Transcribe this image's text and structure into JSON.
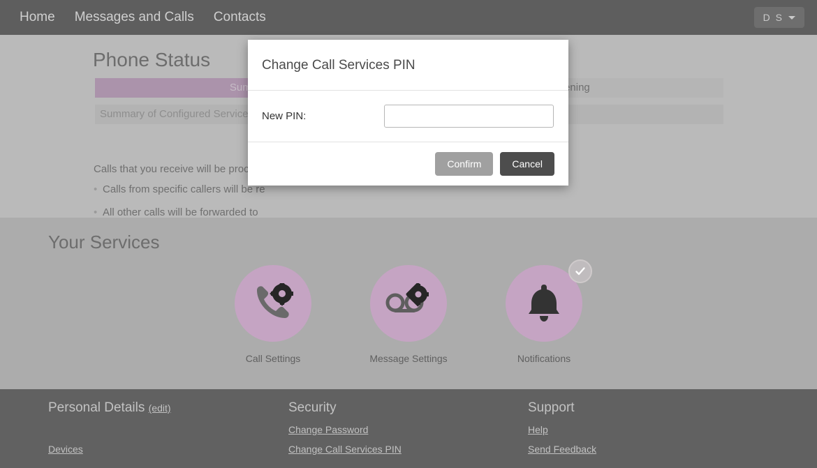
{
  "nav": {
    "links": [
      {
        "label": "Home"
      },
      {
        "label": "Messages and Calls"
      },
      {
        "label": "Contacts"
      }
    ],
    "user_initials": "D S"
  },
  "phone_status": {
    "title": "Phone Status",
    "tabs": [
      {
        "label": "Summary",
        "active": true
      },
      {
        "label": "Screening",
        "active": false
      }
    ],
    "subheader": "Summary of Configured Services",
    "intro": "Calls that you receive will be process",
    "bullets": [
      "Calls from specific callers will be re",
      "All other calls will be forwarded to"
    ]
  },
  "services": {
    "title": "Your Services",
    "items": [
      {
        "label": "Call Settings",
        "icon": "phone-gear-icon",
        "badge": false
      },
      {
        "label": "Message Settings",
        "icon": "voicemail-gear-icon",
        "badge": false
      },
      {
        "label": "Notifications",
        "icon": "bell-icon",
        "badge": true
      }
    ]
  },
  "footer": {
    "columns": [
      {
        "heading": "Personal Details",
        "edit_label": "(edit)",
        "links": [
          {
            "label": "Devices"
          }
        ]
      },
      {
        "heading": "Security",
        "links": [
          {
            "label": "Change Password"
          },
          {
            "label": "Change Call Services PIN"
          }
        ]
      },
      {
        "heading": "Support",
        "links": [
          {
            "label": "Help"
          },
          {
            "label": "Send Feedback"
          }
        ]
      }
    ]
  },
  "modal": {
    "title": "Change Call Services PIN",
    "field_label": "New PIN:",
    "field_value": "",
    "field_placeholder": "",
    "confirm_label": "Confirm",
    "cancel_label": "Cancel"
  },
  "colors": {
    "navbar": "#5e5e5e",
    "page_bg": "#bababa",
    "services_bg": "#acacac",
    "footer_bg": "#616161",
    "accent_purple": "#ab93ab",
    "service_circle": "#c5a4c3",
    "confirm_button": "#a0a0a0",
    "cancel_button": "#4d4d4d"
  }
}
